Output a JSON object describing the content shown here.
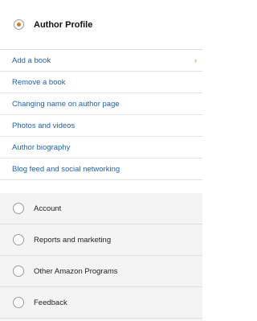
{
  "header": {
    "label": "Author Profile"
  },
  "sub_items": [
    {
      "label": "Add a book"
    },
    {
      "label": "Remove a book"
    },
    {
      "label": "Changing name on author page"
    },
    {
      "label": "Photos and videos"
    },
    {
      "label": "Author biography"
    },
    {
      "label": "Blog feed and social networking"
    }
  ],
  "chevron": "›",
  "other_items": [
    {
      "label": "Account"
    },
    {
      "label": "Reports and marketing"
    },
    {
      "label": "Other Amazon Programs"
    },
    {
      "label": "Feedback"
    }
  ],
  "colors": {
    "link": "#1f62a8",
    "accent": "#e47911",
    "section_bg": "#f4f4f4"
  }
}
